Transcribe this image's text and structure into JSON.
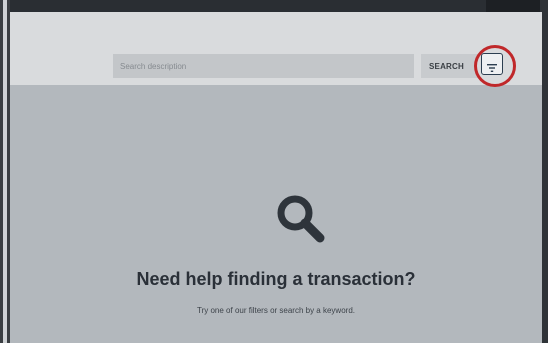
{
  "search": {
    "placeholder": "Search description",
    "button_label": "SEARCH"
  },
  "filter": {
    "icon": "filter-lines-icon",
    "highlight_color": "#c0282a"
  },
  "empty_state": {
    "icon": "magnifier-icon",
    "title": "Need help finding a transaction?",
    "subtitle": "Try one of our filters or search by a keyword."
  }
}
